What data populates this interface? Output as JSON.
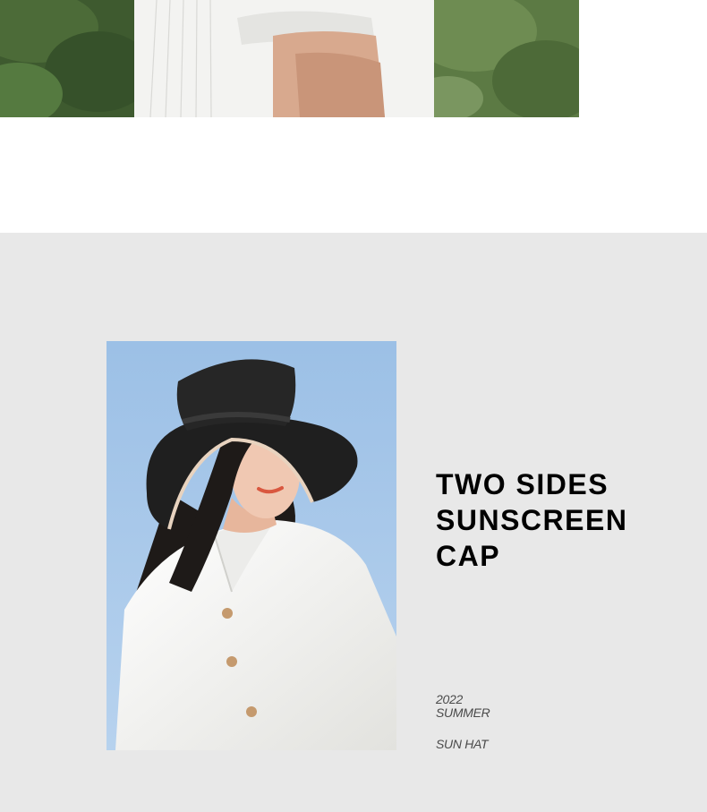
{
  "headline": {
    "line1": "TWO SIDES",
    "line2": "SUNSCREEN",
    "line3": "CAP"
  },
  "meta": {
    "year": "2022",
    "season": "SUMMER",
    "product": "SUN HAT"
  },
  "colors": {
    "grey_background": "#e8e8e8",
    "sky_blue": "#a8c7e6",
    "headline_text": "#000000",
    "meta_text": "#4a4a4a"
  }
}
